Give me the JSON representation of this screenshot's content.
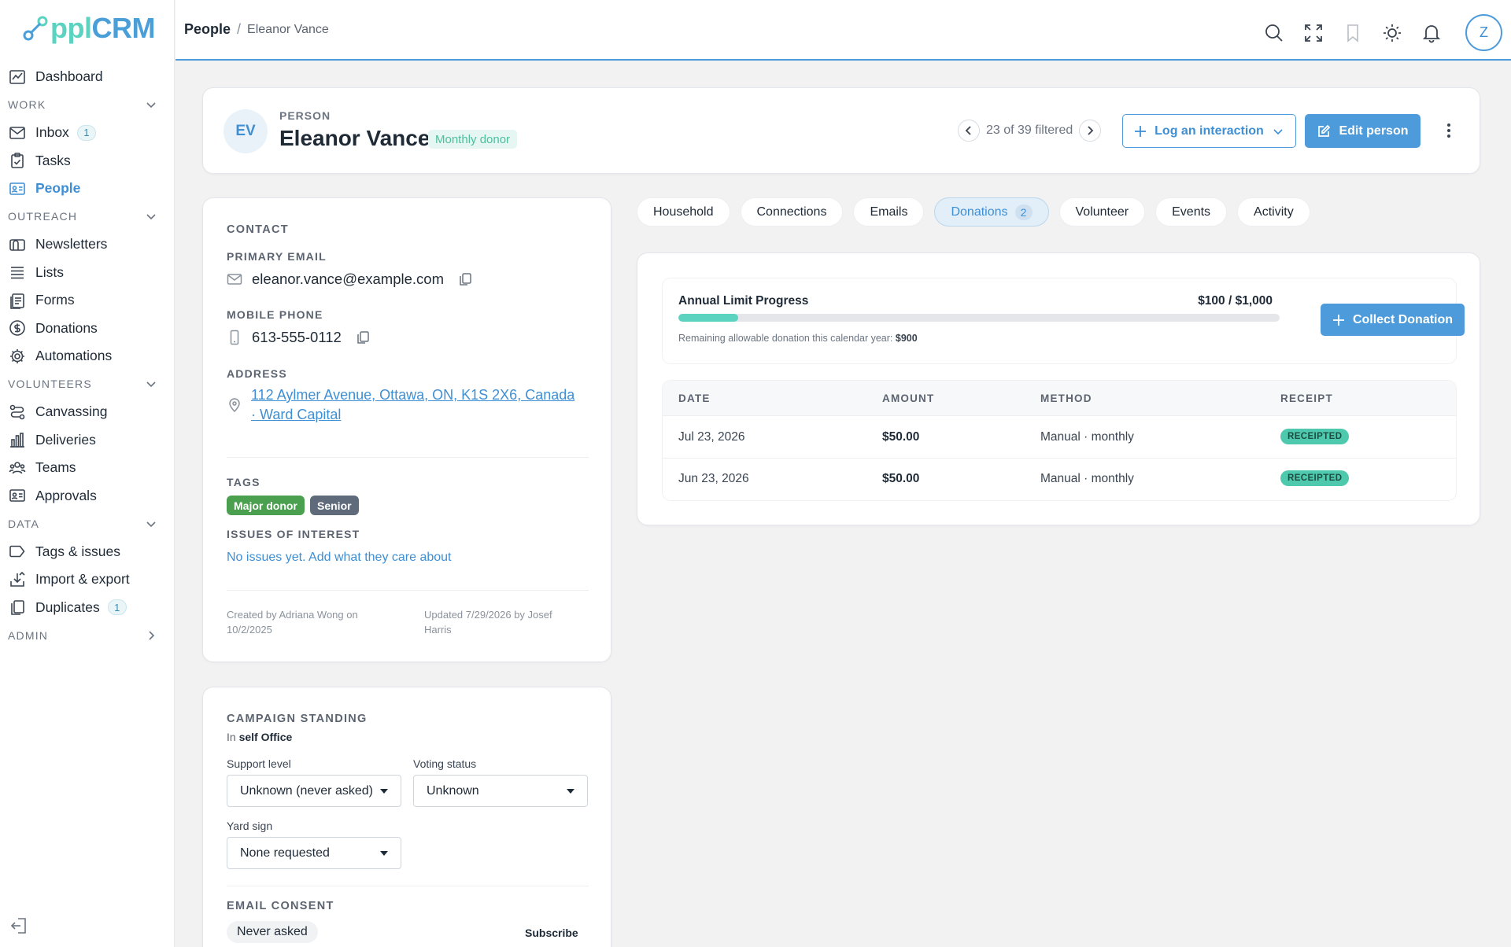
{
  "app": {
    "logo_part1": "ppl",
    "logo_part2": "CRM"
  },
  "sidebar": {
    "dashboard": "Dashboard",
    "sections": [
      {
        "label": "WORK",
        "items": [
          {
            "label": "Inbox",
            "badge": "1",
            "icon": "inbox-icon"
          },
          {
            "label": "Tasks",
            "icon": "clipboard-icon"
          },
          {
            "label": "People",
            "icon": "contact-card-icon"
          }
        ]
      },
      {
        "label": "OUTREACH",
        "items": [
          {
            "label": "Newsletters",
            "icon": "newsletter-icon"
          },
          {
            "label": "Lists",
            "icon": "list-icon"
          },
          {
            "label": "Forms",
            "icon": "form-icon"
          },
          {
            "label": "Donations",
            "icon": "dollar-icon"
          },
          {
            "label": "Automations",
            "icon": "gear-icon"
          }
        ]
      },
      {
        "label": "VOLUNTEERS",
        "items": [
          {
            "label": "Canvassing",
            "icon": "route-icon"
          },
          {
            "label": "Deliveries",
            "icon": "chart-icon"
          },
          {
            "label": "Teams",
            "icon": "team-icon"
          },
          {
            "label": "Approvals",
            "icon": "id-card-icon"
          }
        ]
      },
      {
        "label": "DATA",
        "items": [
          {
            "label": "Tags & issues",
            "icon": "tag-icon"
          },
          {
            "label": "Import & export",
            "icon": "import-icon"
          },
          {
            "label": "Duplicates",
            "badge": "1",
            "icon": "duplicate-icon"
          }
        ]
      },
      {
        "label": "ADMIN",
        "items": []
      }
    ]
  },
  "topbar": {
    "breadcrumb_main": "People",
    "breadcrumb_sep": "/",
    "breadcrumb_sub": "Eleanor Vance",
    "avatar_initial": "Z"
  },
  "person": {
    "initials": "EV",
    "label": "PERSON",
    "name": "Eleanor Vance",
    "badge": "Monthly donor",
    "pager": "23 of 39 filtered",
    "log_interaction": "Log an interaction",
    "edit": "Edit person"
  },
  "contact": {
    "title": "CONTACT",
    "email_label": "PRIMARY EMAIL",
    "email": "eleanor.vance@example.com",
    "phone_label": "MOBILE PHONE",
    "phone": "613-555-0112",
    "address_label": "ADDRESS",
    "address_line1": "112 Aylmer Avenue, Ottawa, ON, K1S 2X6, Canada",
    "address_line2": "· Ward Capital",
    "tags_label": "TAGS",
    "tags": [
      "Major donor",
      "Senior"
    ],
    "issues_label": "ISSUES OF INTEREST",
    "issues_link": "No issues yet. Add what they care about",
    "created_1": "Created by Adriana Wong on",
    "created_2": "10/2/2025",
    "updated_1": "Updated 7/29/2026 by Josef",
    "updated_2": "Harris"
  },
  "campaign": {
    "title": "CAMPAIGN STANDING",
    "in_prefix": "In",
    "in_value": "self Office",
    "support_label": "Support level",
    "support_value": "Unknown (never asked)",
    "voting_label": "Voting status",
    "voting_value": "Unknown",
    "yard_label": "Yard sign",
    "yard_value": "None requested",
    "consent_title": "EMAIL CONSENT",
    "consent_value": "Never asked",
    "subscribe": "Subscribe"
  },
  "tabs": [
    {
      "label": "Household"
    },
    {
      "label": "Connections"
    },
    {
      "label": "Emails"
    },
    {
      "label": "Donations",
      "count": "2",
      "active": true
    },
    {
      "label": "Volunteer"
    },
    {
      "label": "Events"
    },
    {
      "label": "Activity"
    }
  ],
  "donations": {
    "limit_title": "Annual Limit Progress",
    "limit_amount": "$100 / $1,000",
    "progress_fraction": 0.1,
    "remaining_text": "Remaining allowable donation this calendar year:",
    "remaining_value": "$900",
    "collect_button": "Collect Donation",
    "columns": [
      "DATE",
      "AMOUNT",
      "METHOD",
      "RECEIPT"
    ],
    "rows": [
      {
        "date": "Jul 23, 2026",
        "amount": "$50.00",
        "method": "Manual · monthly",
        "receipt": "RECEIPTED"
      },
      {
        "date": "Jun 23, 2026",
        "amount": "$50.00",
        "method": "Manual · monthly",
        "receipt": "RECEIPTED"
      }
    ]
  },
  "colors": {
    "accent": "#4e9bdb",
    "teal": "#5cd3c0",
    "receipt": "#4fc9ad",
    "tag_green": "#4aa04f",
    "tag_grey": "#5f6b7a"
  }
}
